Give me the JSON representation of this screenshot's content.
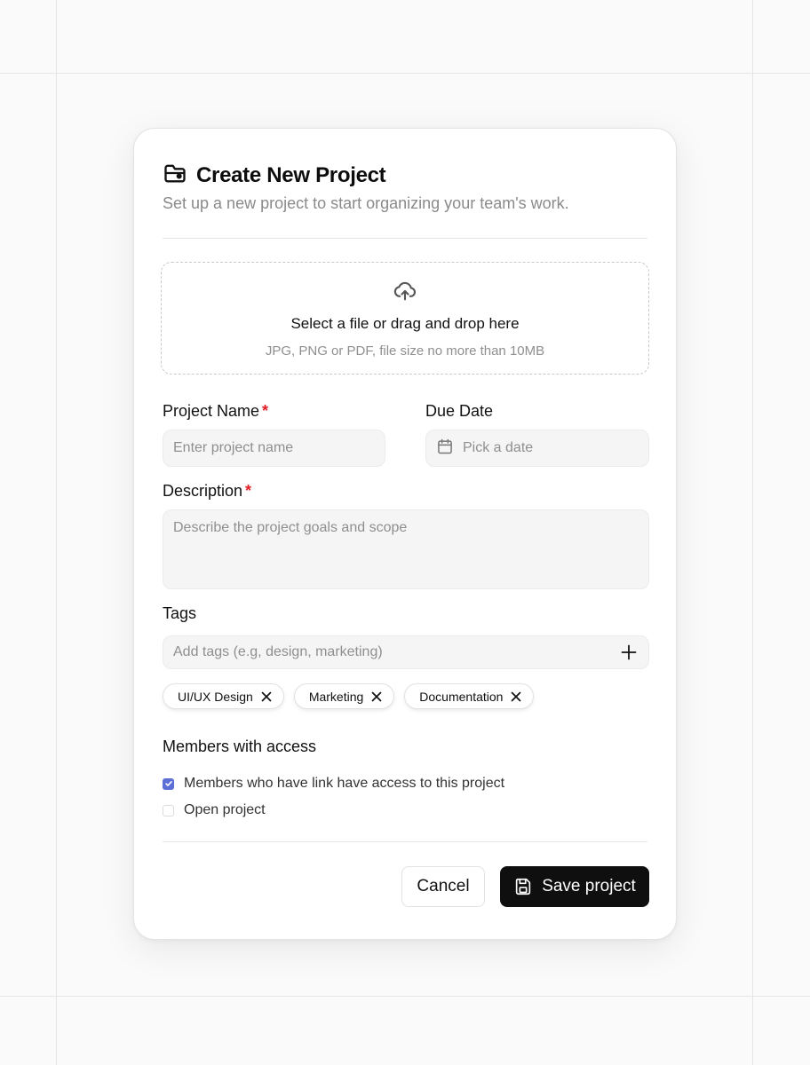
{
  "dialog": {
    "title": "Create New Project",
    "subtitle": "Set up a new project to start organizing your team's work.",
    "title_icon": "folder-open-icon"
  },
  "upload": {
    "icon": "cloud-upload-icon",
    "title": "Select a file or drag and drop here",
    "hint": "JPG, PNG or PDF, file size no more than 10MB"
  },
  "fields": {
    "project_name": {
      "label": "Project Name",
      "required_mark": "*",
      "placeholder": "Enter project name",
      "value": ""
    },
    "due_date": {
      "label": "Due Date",
      "placeholder": "Pick a date",
      "icon": "calendar-icon"
    },
    "description": {
      "label": "Description",
      "required_mark": "*",
      "placeholder": "Describe the project goals and scope",
      "value": ""
    },
    "tags": {
      "label": "Tags",
      "placeholder": "Add tags (e.g, design, marketing)",
      "add_icon": "plus-icon"
    }
  },
  "tags": [
    {
      "label": "UI/UX Design"
    },
    {
      "label": "Marketing"
    },
    {
      "label": "Documentation"
    }
  ],
  "access": {
    "heading": "Members with access",
    "options": [
      {
        "label": "Members who have link have access to this project",
        "checked": true
      },
      {
        "label": "Open project",
        "checked": false
      }
    ]
  },
  "actions": {
    "cancel_label": "Cancel",
    "save_label": "Save project",
    "save_icon": "save-icon"
  },
  "colors": {
    "required": "#e11d24",
    "checkbox_checked": "#5b6fd6",
    "primary_button": "#0f0f0f"
  }
}
